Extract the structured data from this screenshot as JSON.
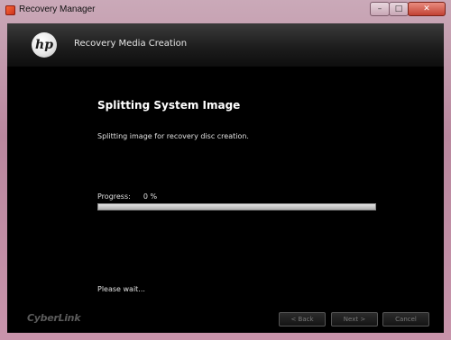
{
  "window": {
    "title": "Recovery Manager",
    "controls": {
      "minimize": "–",
      "maximize": "□",
      "close": "✕"
    }
  },
  "header": {
    "logo_text": "hp",
    "title": "Recovery Media Creation"
  },
  "content": {
    "step_title": "Splitting System Image",
    "description": "Splitting image for recovery disc creation.",
    "progress_label": "Progress:",
    "progress_value": "0 %",
    "progress_fraction": 0,
    "status": "Please wait..."
  },
  "footer": {
    "brand": "CyberLink",
    "back_label": "< Back",
    "next_label": "Next >",
    "cancel_label": "Cancel"
  },
  "colors": {
    "frame": "#c0a4b0",
    "client_bg": "#000000",
    "progress_fill": "#35c64a"
  }
}
